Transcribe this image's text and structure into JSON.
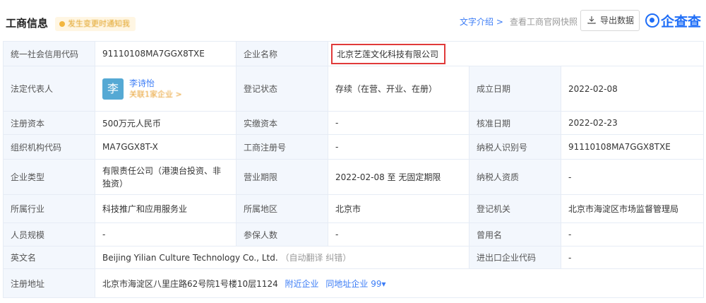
{
  "header": {
    "title": "工商信息",
    "badge": "发生变更时通知我",
    "intro_link": "文字介绍 >",
    "official_link": "查看工商官网快照",
    "export_label": "导出数据",
    "logo_text": "企查查"
  },
  "rows": {
    "credit_code_label": "统一社会信用代码",
    "credit_code": "91110108MA7GGX8TXE",
    "company_name_label": "企业名称",
    "company_name": "北京艺莲文化科技有限公司",
    "legal_rep_label": "法定代表人",
    "legal_rep_avatar": "李",
    "legal_rep_name": "李诗怡",
    "legal_rep_sub": "关联1家企业 >",
    "reg_status_label": "登记状态",
    "reg_status": "存续（在营、开业、在册）",
    "found_date_label": "成立日期",
    "found_date": "2022-02-08",
    "capital_label": "注册资本",
    "capital": "500万元人民币",
    "paid_capital_label": "实缴资本",
    "paid_capital": "-",
    "approve_date_label": "核准日期",
    "approve_date": "2022-02-23",
    "org_code_label": "组织机构代码",
    "org_code": "MA7GGX8T-X",
    "reg_no_label": "工商注册号",
    "reg_no": "-",
    "taxpayer_id_label": "纳税人识别号",
    "taxpayer_id": "91110108MA7GGX8TXE",
    "company_type_label": "企业类型",
    "company_type": "有限责任公司（港澳台投资、非独资）",
    "term_label": "营业期限",
    "term": "2022-02-08 至 无固定期限",
    "taxpayer_quality_label": "纳税人资质",
    "taxpayer_quality": "-",
    "industry_label": "所属行业",
    "industry": "科技推广和应用服务业",
    "region_label": "所属地区",
    "region": "北京市",
    "authority_label": "登记机关",
    "authority": "北京市海淀区市场监督管理局",
    "staff_label": "人员规模",
    "staff": "-",
    "insured_label": "参保人数",
    "insured": "-",
    "former_name_label": "曾用名",
    "former_name": "-",
    "english_name_label": "英文名",
    "english_name": "Beijing Yilian Culture Technology Co., Ltd.",
    "english_note": "（自动翻译 纠错）",
    "import_export_label": "进出口企业代码",
    "import_export": "-",
    "address_label": "注册地址",
    "address": "北京市海淀区八里庄路62号院1号楼10层1124",
    "nearby_link": "附近企业",
    "same_address_link": "同地址企业 99▾"
  }
}
